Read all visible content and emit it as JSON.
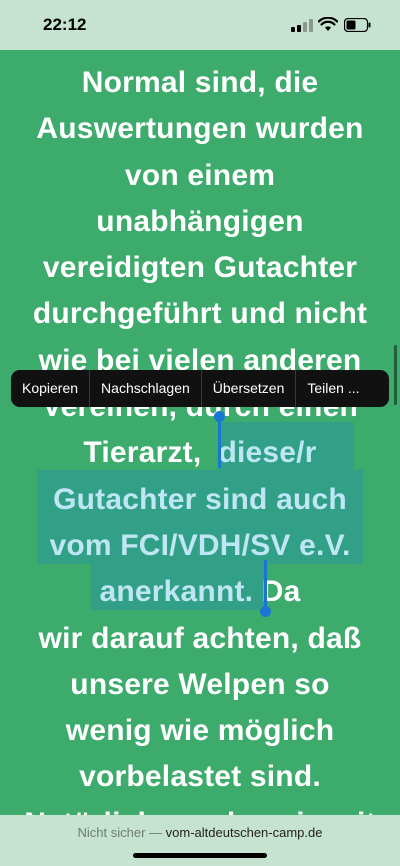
{
  "status_bar": {
    "time": "22:12"
  },
  "article": {
    "lines_before_selection": [
      "Normal sind, die",
      "Auswertungen wurden",
      "von einem",
      "unabhängigen",
      "vereidigten Gutachter",
      "durchgeführt und nicht",
      "wie bei vielen anderen",
      "Vereinen, durch einen"
    ],
    "line_tierarzt_prefix": "Tierarzt, ",
    "selected_text_line1": "diese/r",
    "selected_text_line2": "Gutachter sind auch",
    "selected_text_line3": "vom FCI/VDH/SV e.V.",
    "selected_text_line4": "anerkannt.",
    "after_selection_same_line": " Da",
    "lines_after_selection": [
      "wir darauf achten, daß",
      "unsere Welpen so",
      "wenig wie möglich",
      "vorbelastet sind.",
      "Natürlich werden sie mit"
    ]
  },
  "context_menu": {
    "items": [
      "Kopieren",
      "Nachschlagen",
      "Übersetzen",
      "Teilen ..."
    ]
  },
  "address_bar": {
    "security_label": "Nicht sicher —",
    "domain": "vom-altdeutschen-camp.de"
  },
  "colors": {
    "background": "#3cab6b",
    "selection_highlight": "#2f9d8c",
    "selection_text": "#bfe6f4",
    "handle": "#1976d2"
  }
}
